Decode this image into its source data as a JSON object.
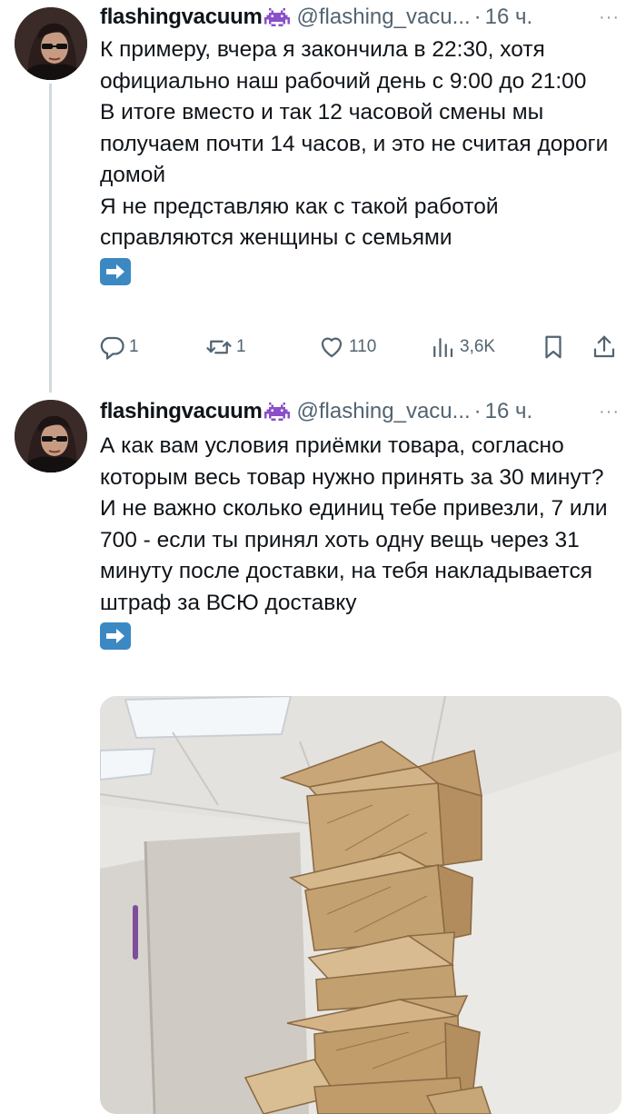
{
  "tweets": [
    {
      "display_name": "flashingvacuum",
      "badge_icon": "space-invader-icon",
      "handle": "@flashing_vacu...",
      "separator": "·",
      "time": "16 ч.",
      "more_label": "···",
      "paragraphs": [
        "К примеру, вчера я закончила в 22:30, хотя официально наш рабочий день с 9:00 до 21:00",
        "В итоге вместо и так 12 часовой смены мы получаем почти 14 часов, и это не считая дороги домой",
        "Я не представляю как с такой работой справляются женщины с семьями"
      ],
      "emoji": "➡️",
      "stats": {
        "replies": "1",
        "retweets": "1",
        "likes": "110",
        "views": "3,6K"
      }
    },
    {
      "display_name": "flashingvacuum",
      "badge_icon": "space-invader-icon",
      "handle": "@flashing_vacu...",
      "separator": "·",
      "time": "16 ч.",
      "more_label": "···",
      "paragraphs": [
        "А как вам условия приёмки товара, согласно которым весь товар нужно принять за 30 минут? И не важно сколько единиц тебе привезли, 7 или 700 - если ты принял хоть одну вещь через 31 минуту после доставки, на тебя накладывается штраф за ВСЮ доставку"
      ],
      "emoji": "➡️",
      "media_icon": "photo-stacked-cardboard-boxes"
    }
  ],
  "colors": {
    "text": "#0f1419",
    "secondary": "#536471",
    "thread_line": "#cfd9de",
    "emoji_blue": "#3b88c3",
    "badge_purple": "#8a4fc9"
  }
}
